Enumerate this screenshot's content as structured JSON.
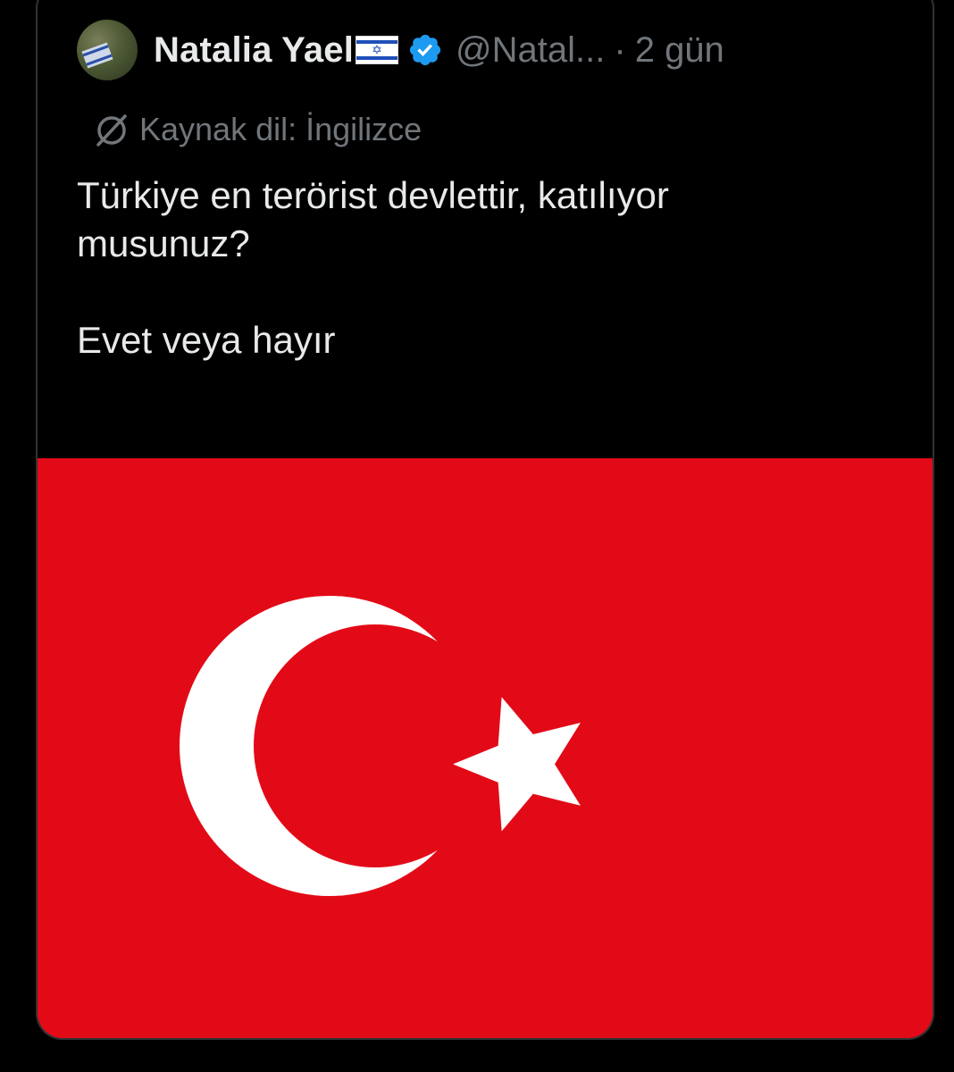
{
  "tweet": {
    "author_name": "Natalia Yael",
    "author_flag_icon": "israel-flag-icon",
    "verified_icon": "verified-badge-icon",
    "handle": "@Natal...",
    "separator": "·",
    "time": "2 gün",
    "translation_label": "Kaynak dil: İngilizce",
    "text_line1": "Türkiye en terörist devlettir, katılıyor",
    "text_line2": "musunuz?",
    "text_line3": "Evet veya hayır"
  },
  "media": {
    "description_icon": "turkey-flag-image",
    "colors": {
      "flag_red": "#e30a17",
      "flag_white": "#ffffff",
      "verified_blue": "#1d9bf0"
    }
  }
}
